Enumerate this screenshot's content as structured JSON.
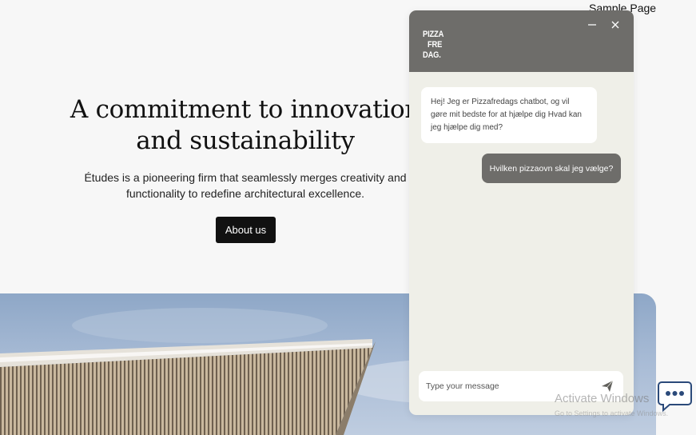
{
  "nav": {
    "sample_page": "Sample Page"
  },
  "hero": {
    "title_line1": "A commitment to innovation",
    "title_line2": "and sustainability",
    "desc_line1": "Études is a pioneering firm that seamlessly merges creativity and",
    "desc_line2": "functionality to redefine architectural excellence.",
    "button": "About us"
  },
  "chat": {
    "logo": {
      "line1": "PIZZA",
      "line2": "FRE",
      "line3": "DAG."
    },
    "bot_message": "Hej! Jeg er Pizzafredags chatbot, og vil gøre mit bedste for at hjælpe dig Hvad kan jeg hjælpe dig med?",
    "user_message": "Hvilken pizzaovn skal jeg vælge?",
    "input_placeholder": "Type your message",
    "colors": {
      "header": "#6e6d6a",
      "body": "#efefe8",
      "user_bubble": "#6e6d6a"
    }
  },
  "watermark": {
    "title": "Activate Windows",
    "subtitle": "Go to Settings to activate Windows."
  },
  "icons": {
    "minimize": "minimize-icon",
    "close": "close-icon",
    "send": "send-icon",
    "launcher": "chat-bubble-icon"
  }
}
